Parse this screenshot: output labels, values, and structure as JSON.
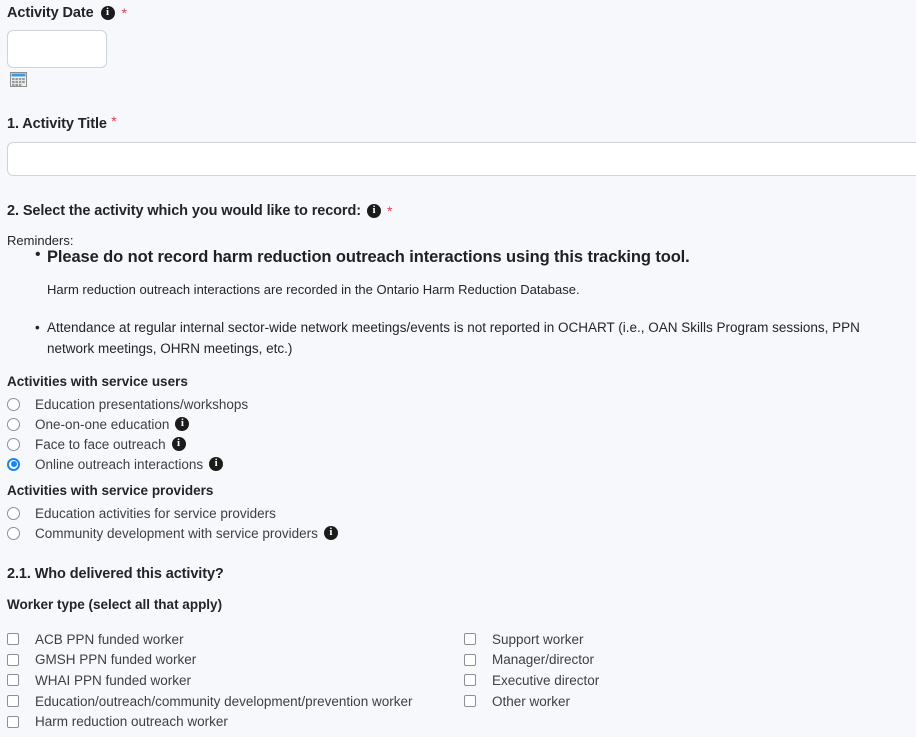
{
  "form": {
    "activity_date": {
      "label": "Activity Date",
      "info_icon": "info-icon",
      "required_marker": "*",
      "value": "",
      "placeholder": "",
      "calendar_icon": "calendar-icon"
    },
    "q1": {
      "label": "1. Activity Title",
      "required_marker": "*",
      "value": "",
      "placeholder": ""
    },
    "q2": {
      "label": "2. Select the activity which you would like to record:",
      "info_icon": "info-icon",
      "required_marker": "*",
      "reminders_title": "Reminders:",
      "reminders": [
        {
          "text": "Please do not record harm reduction outreach interactions using this tracking tool.",
          "sub": "Harm reduction outreach interactions are recorded in the Ontario Harm Reduction Database."
        },
        {
          "text": "Attendance at regular internal sector-wide network meetings/events is not reported in OCHART (i.e., OAN Skills Program sessions, PPN network meetings, OHRN meetings, etc.)"
        }
      ],
      "groups": [
        {
          "heading": "Activities with service users",
          "options": [
            {
              "label": "Education presentations/workshops",
              "selected": false,
              "has_info": false
            },
            {
              "label": "One-on-one education",
              "selected": false,
              "has_info": true
            },
            {
              "label": "Face to face outreach",
              "selected": false,
              "has_info": true
            },
            {
              "label": "Online outreach interactions",
              "selected": true,
              "has_info": true
            }
          ]
        },
        {
          "heading": "Activities with service providers",
          "options": [
            {
              "label": "Education activities for service providers",
              "selected": false,
              "has_info": false
            },
            {
              "label": "Community development with service providers",
              "selected": false,
              "has_info": true
            }
          ]
        }
      ]
    },
    "q2_1": {
      "label": "2.1. Who delivered this activity?",
      "worker_type_label": "Worker type (select all that apply)",
      "left_column": [
        {
          "label": "ACB PPN funded worker",
          "checked": false
        },
        {
          "label": "GMSH PPN funded worker",
          "checked": false
        },
        {
          "label": "WHAI PPN funded worker",
          "checked": false
        },
        {
          "label": "Education/outreach/community development/prevention worker",
          "checked": false
        },
        {
          "label": "Harm reduction outreach worker",
          "checked": false
        }
      ],
      "right_column": [
        {
          "label": "Support worker",
          "checked": false
        },
        {
          "label": "Manager/director",
          "checked": false
        },
        {
          "label": "Executive director",
          "checked": false
        },
        {
          "label": "Other worker",
          "checked": false
        }
      ]
    }
  },
  "colors": {
    "background": "#f7f8fc",
    "text": "#212529",
    "required": "#e8384f",
    "accent": "#1a85f0",
    "input_border": "#ced4da",
    "info_badge": "#1b1b1b"
  }
}
